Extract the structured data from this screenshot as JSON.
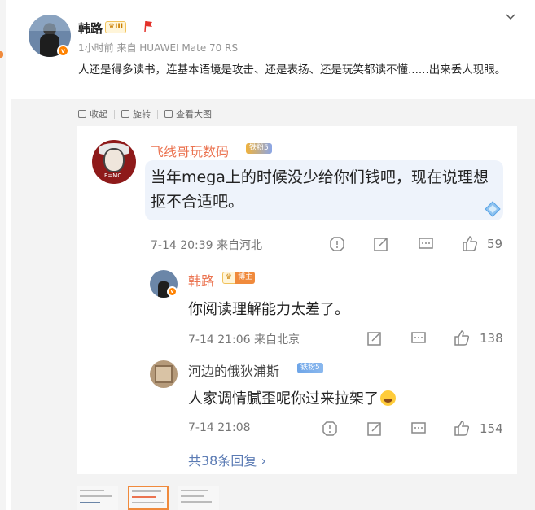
{
  "post": {
    "author": "韩路",
    "author_badge": "III",
    "meta": "1小时前  来自 HUAWEI Mate 70 RS",
    "text": "人还是得多读书，连基本语境是攻击、还是表扬、还是玩笑都读不懂......出来丢人现眼。"
  },
  "toolbar": {
    "collapse": "收起",
    "rotate": "旋转",
    "view_large": "查看大图"
  },
  "comment": {
    "name": "飞线哥玩数码",
    "fan_badge": "铁粉5",
    "text": "当年mega上的时候没少给你们钱吧，现在说理想抠不合适吧。",
    "time": "7-14 20:39  来自河北",
    "likes": "59",
    "avatar_text": "E=MC"
  },
  "replies": [
    {
      "name": "韩路",
      "badge": "博主",
      "text": "你阅读理解能力太差了。",
      "time": "7-14 21:06  来自北京",
      "likes": "138"
    },
    {
      "name": "河边的俄狄浦斯",
      "badge": "铁粉5",
      "text": "人家调情腻歪呢你过来拉架了",
      "time": "7-14 21:08",
      "likes": "154"
    }
  ],
  "more_replies": "共38条回复 ›",
  "colors": {
    "accent_orange": "#eb7350",
    "link_blue": "#5b7bb4",
    "bubble_bg": "#eef3fb"
  },
  "icons": [
    "chevron-down-icon",
    "flag-icon",
    "report-icon",
    "forward-icon",
    "comment-icon",
    "like-icon",
    "diamond-icon",
    "laugh-emoji-icon"
  ]
}
